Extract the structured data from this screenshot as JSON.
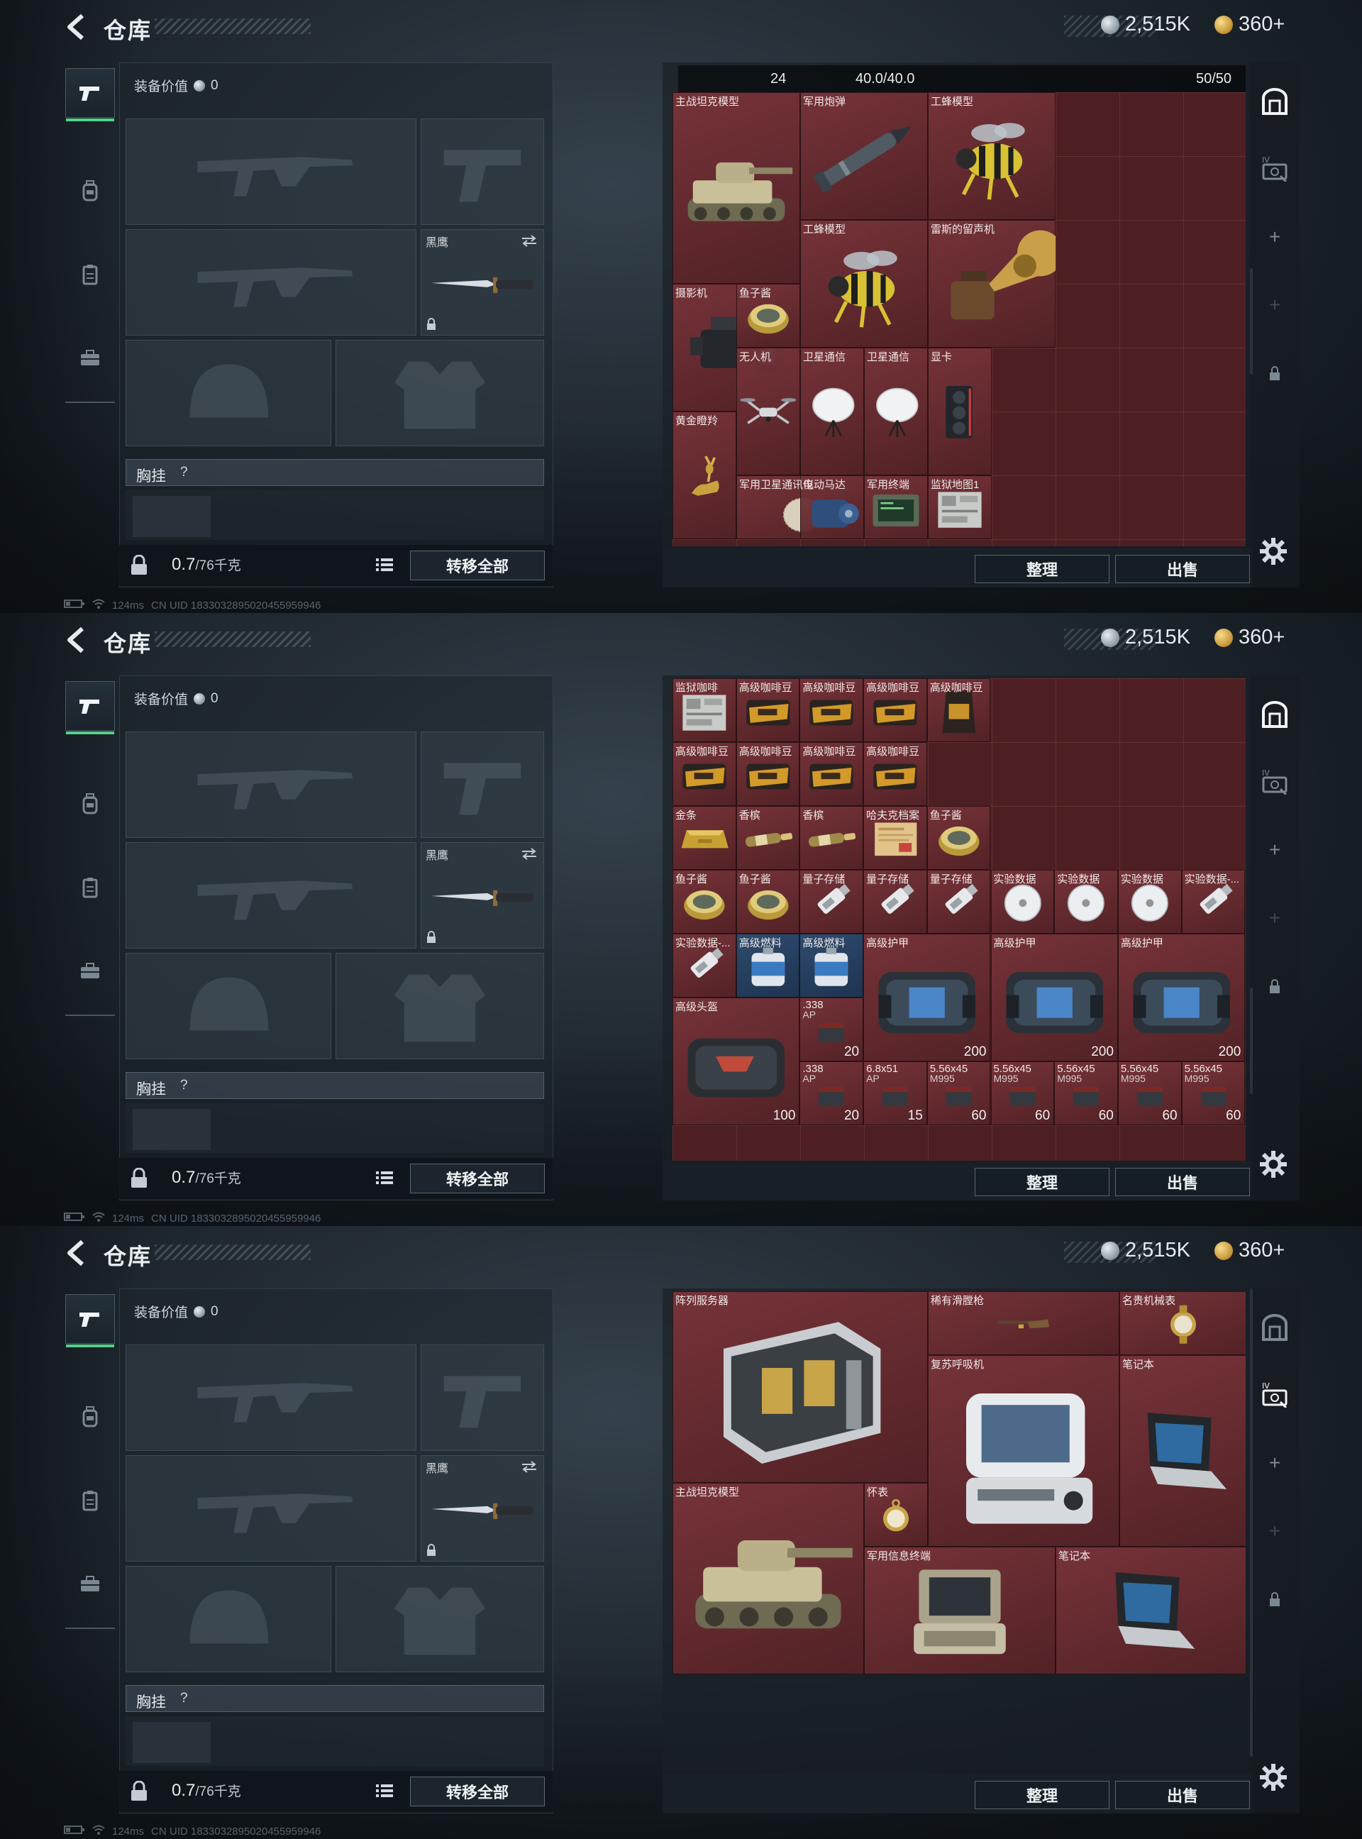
{
  "header": {
    "title": "仓库",
    "currency_silver": "2,515K",
    "currency_gold": "360+"
  },
  "equipment": {
    "value_label": "装备价值",
    "value": "0",
    "melee_label": "黑鹰",
    "rig_label": "胸挂",
    "rig_help": "?",
    "weight_current": "0.7",
    "weight_max": "/76千克",
    "transfer_all": "转移全部"
  },
  "status": {
    "ping": "124ms",
    "uid": "CN UID 1833032895020455959946"
  },
  "warehouse": {
    "sort_label": "整理",
    "sell_label": "出售",
    "info": {
      "count": "24",
      "weight": "40.0/40.0",
      "slots": "50/50"
    }
  },
  "screens": [
    {
      "items": [
        {
          "name": "主战坦克模型",
          "art": "tank-icon"
        },
        {
          "name": "军用炮弹",
          "art": "shell-icon"
        },
        {
          "name": "工蜂模型",
          "art": "bee-icon"
        },
        {
          "name": "工蜂模型",
          "art": "bee-icon"
        },
        {
          "name": "雷斯的留声机",
          "art": "gramophone-icon"
        },
        {
          "name": "摄影机",
          "art": "camera-icon"
        },
        {
          "name": "鱼子酱",
          "art": "caviar-icon"
        },
        {
          "name": "无人机",
          "art": "drone-icon"
        },
        {
          "name": "卫星通信",
          "art": "satellite-dish-icon"
        },
        {
          "name": "卫星通信",
          "art": "satellite-dish-icon"
        },
        {
          "name": "显卡",
          "art": "gpu-icon"
        },
        {
          "name": "黄金瞪羚",
          "art": "gazelle-icon"
        },
        {
          "name": "军用卫星通讯仪",
          "art": "sat-comm-icon"
        },
        {
          "name": "电动马达",
          "art": "motor-icon"
        },
        {
          "name": "军用终端",
          "art": "terminal-icon"
        },
        {
          "name": "监狱地图1",
          "art": "map-icon"
        }
      ]
    },
    {
      "items": [
        {
          "name": "监狱咖啡",
          "art": "map-icon"
        },
        {
          "name": "高级咖啡豆",
          "art": "coffee-icon"
        },
        {
          "name": "高级咖啡豆",
          "art": "coffee-icon"
        },
        {
          "name": "高级咖啡豆",
          "art": "coffee-icon"
        },
        {
          "name": "高级咖啡豆",
          "art": "coffee-bag-icon"
        },
        {
          "name": "高级咖啡豆",
          "art": "coffee-icon"
        },
        {
          "name": "高级咖啡豆",
          "art": "coffee-icon"
        },
        {
          "name": "高级咖啡豆",
          "art": "coffee-icon"
        },
        {
          "name": "高级咖啡豆",
          "art": "coffee-icon"
        },
        {
          "name": "金条",
          "art": "gold-bar-icon"
        },
        {
          "name": "香槟",
          "art": "champagne-icon"
        },
        {
          "name": "香槟",
          "art": "champagne-icon"
        },
        {
          "name": "哈夫克档案",
          "art": "file-icon"
        },
        {
          "name": "鱼子酱",
          "art": "caviar-icon"
        },
        {
          "name": "鱼子酱",
          "art": "caviar-icon"
        },
        {
          "name": "鱼子酱",
          "art": "caviar-icon"
        },
        {
          "name": "量子存储",
          "art": "usb-icon"
        },
        {
          "name": "量子存储",
          "art": "usb-icon"
        },
        {
          "name": "量子存储",
          "art": "usb-icon"
        },
        {
          "name": "实验数据",
          "art": "disc-icon"
        },
        {
          "name": "实验数据",
          "art": "disc-icon"
        },
        {
          "name": "实验数据",
          "art": "disc-icon"
        },
        {
          "name": "实验数据-...",
          "art": "usb-icon"
        },
        {
          "name": "实验数据-...",
          "art": "usb-icon"
        },
        {
          "name": "高级燃料",
          "art": "fuel-icon"
        },
        {
          "name": "高级燃料",
          "art": "fuel-icon"
        },
        {
          "name": "高级护甲",
          "art": "armor-bag-icon",
          "value": "200"
        },
        {
          "name": "高级护甲",
          "art": "armor-bag-icon",
          "value": "200"
        },
        {
          "name": "高级护甲",
          "art": "armor-bag-icon",
          "value": "200"
        },
        {
          "name": "高级头盔",
          "art": "helmet-bag-icon",
          "value": "100"
        },
        {
          "name": ".338",
          "sub": "AP",
          "art": "ammo-icon",
          "value": "20"
        },
        {
          "name": ".338",
          "sub": "AP",
          "art": "ammo-icon",
          "value": "20"
        },
        {
          "name": "6.8x51",
          "sub": "AP",
          "art": "ammo-icon",
          "value": "15"
        },
        {
          "name": "5.56x45",
          "sub": "M995",
          "art": "ammo-icon",
          "value": "60"
        },
        {
          "name": "5.56x45",
          "sub": "M995",
          "art": "ammo-icon",
          "value": "60"
        },
        {
          "name": "5.56x45",
          "sub": "M995",
          "art": "ammo-icon",
          "value": "60"
        },
        {
          "name": "5.56x45",
          "sub": "M995",
          "art": "ammo-icon",
          "value": "60"
        },
        {
          "name": "5.56x45",
          "sub": "M995",
          "art": "ammo-icon",
          "value": "60"
        }
      ]
    },
    {
      "items": [
        {
          "name": "阵列服务器",
          "art": "server-icon"
        },
        {
          "name": "稀有滑膛枪",
          "art": "musket-icon"
        },
        {
          "name": "名贵机械表",
          "art": "watch-icon"
        },
        {
          "name": "复苏呼吸机",
          "art": "ventilator-icon"
        },
        {
          "name": "笔记本",
          "art": "laptop-icon"
        },
        {
          "name": "主战坦克模型",
          "art": "tank-icon"
        },
        {
          "name": "怀表",
          "art": "pocket-watch-icon"
        },
        {
          "name": "军用信息终端",
          "art": "rugged-terminal-icon"
        },
        {
          "name": "笔记本",
          "art": "laptop-icon"
        }
      ]
    }
  ]
}
